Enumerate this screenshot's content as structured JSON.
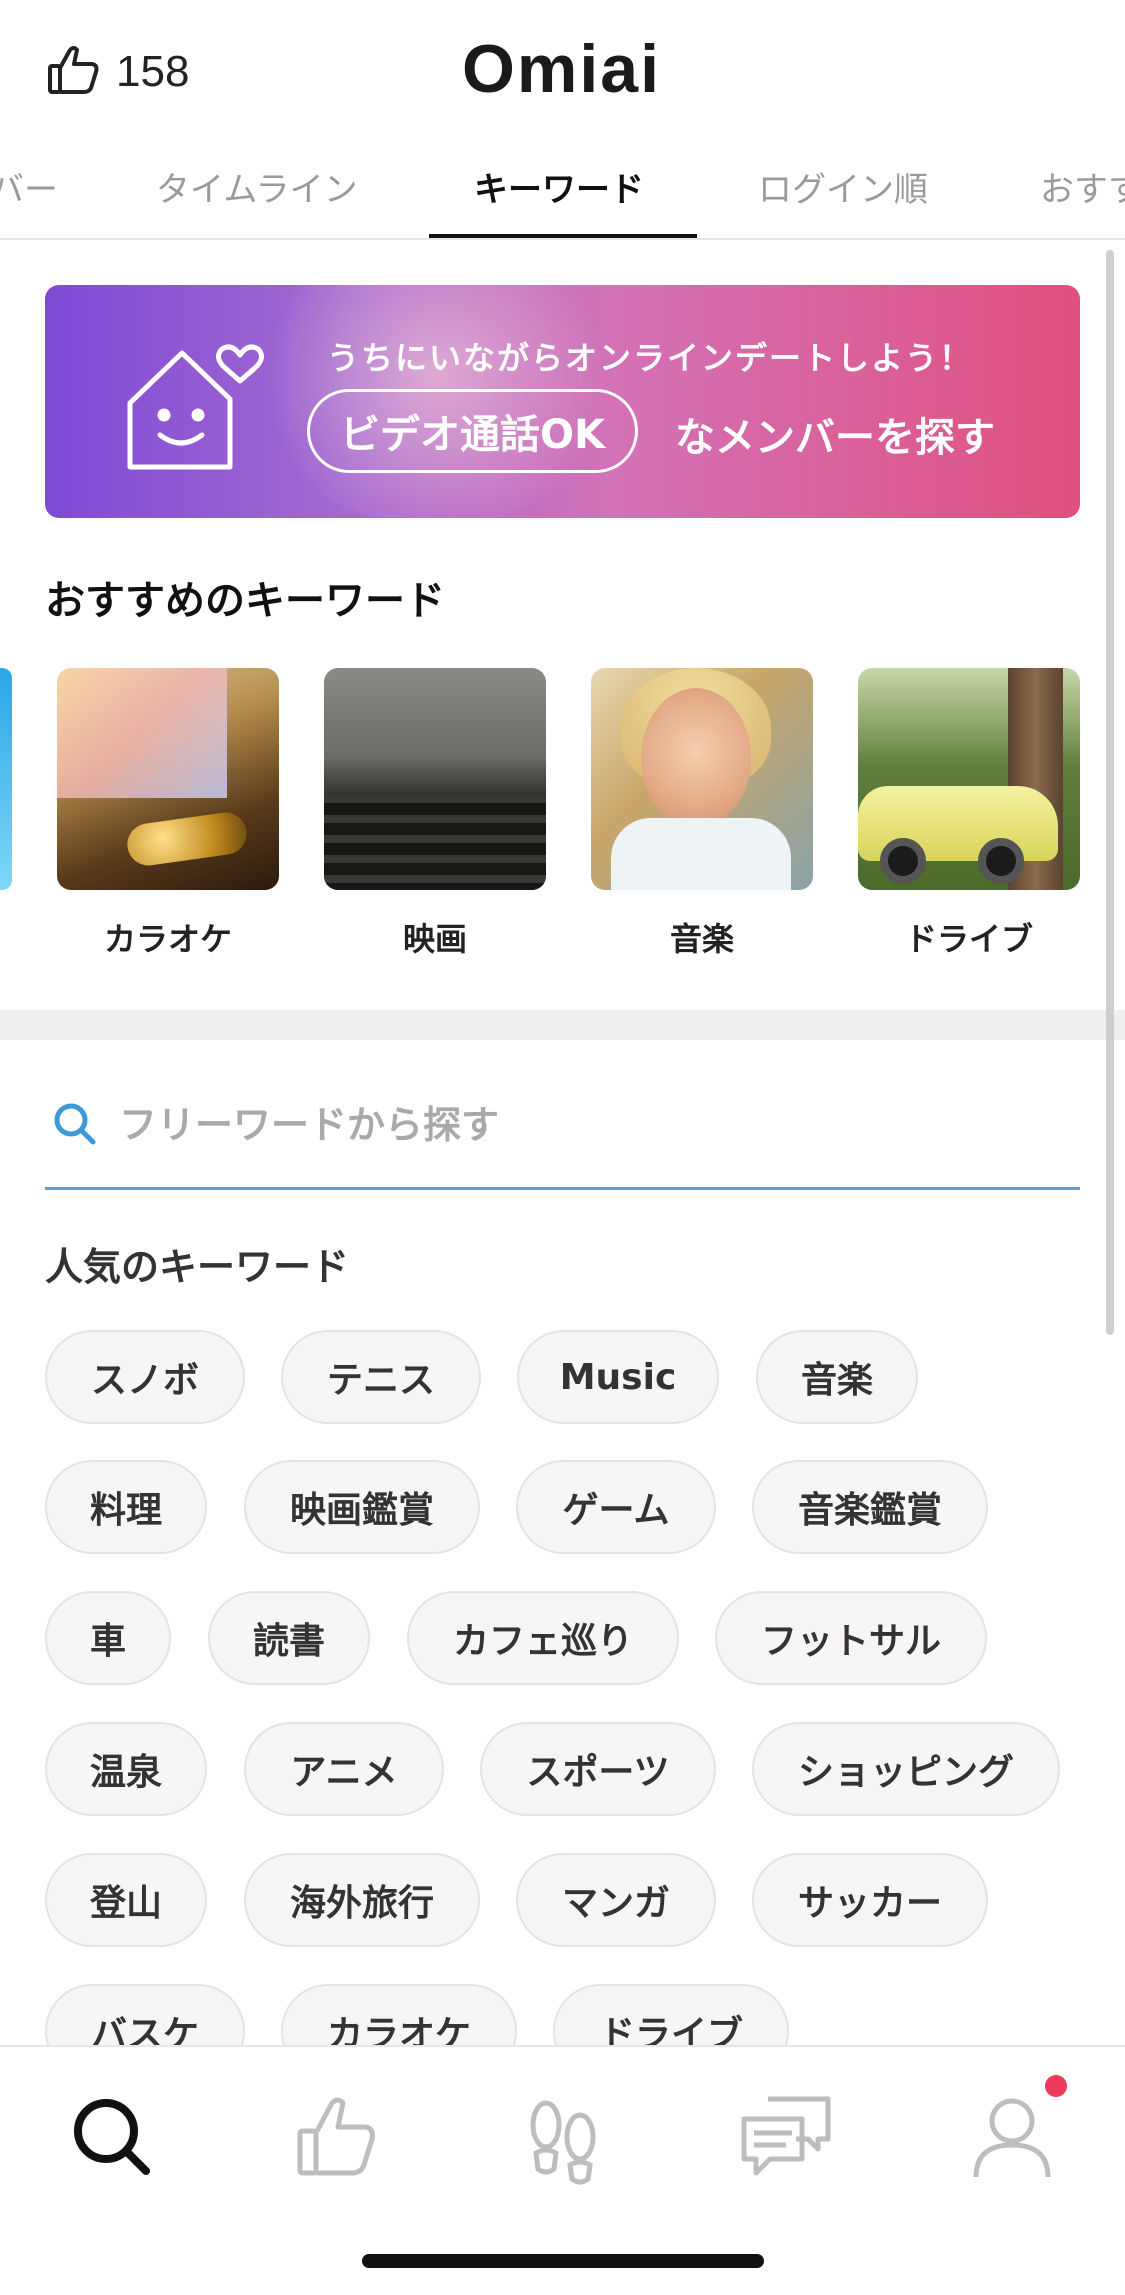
{
  "header": {
    "likes_count": "158",
    "logo": "Omiai"
  },
  "tabs": [
    {
      "label": "バー",
      "active": false
    },
    {
      "label": "タイムライン",
      "active": false
    },
    {
      "label": "キーワード",
      "active": true
    },
    {
      "label": "ログイン順",
      "active": false
    },
    {
      "label": "おすす",
      "active": false
    }
  ],
  "banner": {
    "top_text": "うちにいながらオンラインデートしよう！",
    "pill_text": "ビデオ通話OK",
    "rest_text": "なメンバーを探す"
  },
  "recommended": {
    "title": "おすすめのキーワード",
    "items": [
      {
        "label": "カラオケ"
      },
      {
        "label": "映画"
      },
      {
        "label": "音楽"
      },
      {
        "label": "ドライブ"
      }
    ]
  },
  "search": {
    "placeholder": "フリーワードから探す",
    "value": ""
  },
  "popular": {
    "title": "人気のキーワード",
    "chips": [
      "スノボ",
      "テニス",
      "Music",
      "音楽",
      "料理",
      "映画鑑賞",
      "ゲーム",
      "音楽鑑賞",
      "車",
      "読書",
      "カフェ巡り",
      "フットサル",
      "温泉",
      "アニメ",
      "スポーツ",
      "ショッピング",
      "登山",
      "海外旅行",
      "マンガ",
      "サッカー",
      "バスケ",
      "カラオケ",
      "ドライブ"
    ]
  },
  "bottom_nav": [
    {
      "icon": "search-icon",
      "active": true
    },
    {
      "icon": "thumbs-up-icon",
      "active": false
    },
    {
      "icon": "footprints-icon",
      "active": false
    },
    {
      "icon": "messages-icon",
      "active": false
    },
    {
      "icon": "profile-icon",
      "active": false,
      "has_notification": true
    }
  ],
  "colors": {
    "banner_gradient_start": "#7d4ad6",
    "banner_gradient_end": "#e0507f",
    "search_underline": "#5aa0d6",
    "notification_dot": "#f03a5c",
    "chip_background": "#f7f6f4"
  }
}
